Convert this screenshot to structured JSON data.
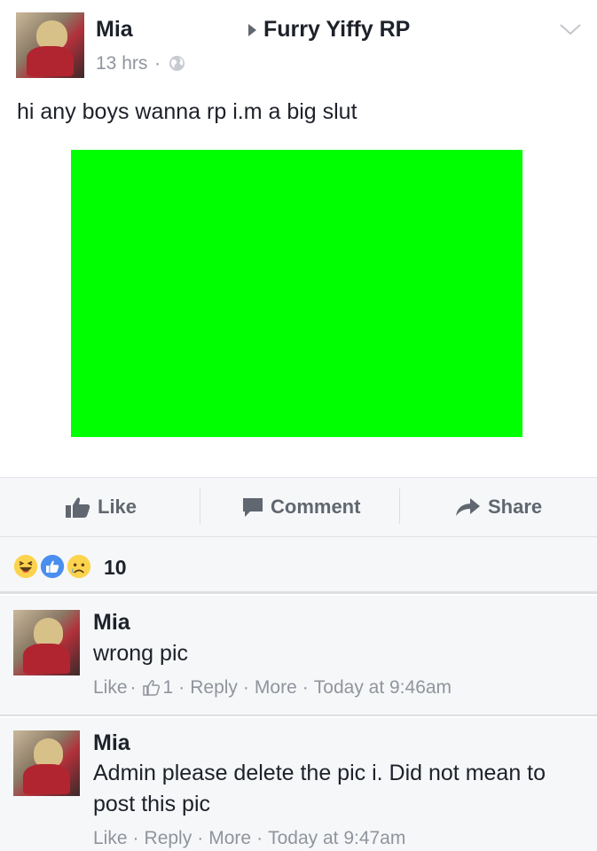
{
  "post": {
    "author": "Mia",
    "group": "Furry Yiffy RP",
    "time": "13 hrs",
    "separator": "·",
    "text": "hi any boys wanna rp i.m a big slut",
    "image_color": "#00ff00"
  },
  "actions": {
    "like": "Like",
    "comment": "Comment",
    "share": "Share"
  },
  "reactions": {
    "icons": [
      "haha-icon",
      "like-icon",
      "sad-icon"
    ],
    "count": "10"
  },
  "comments": [
    {
      "author": "Mia",
      "text": "wrong pic",
      "like": "Like",
      "like_count": "1",
      "reply": "Reply",
      "more": "More",
      "time": "Today at 9:46am"
    },
    {
      "author": "Mia",
      "text": "Admin please delete the pic i. Did not mean to post this pic",
      "like": "Like",
      "reply": "Reply",
      "more": "More",
      "time": "Today at 9:47am"
    }
  ],
  "colors": {
    "text": "#1d2129",
    "secondary": "#90949c",
    "action_gray": "#606770",
    "like_blue": "#4267b2",
    "reaction_yellow": "#fcd34d"
  }
}
